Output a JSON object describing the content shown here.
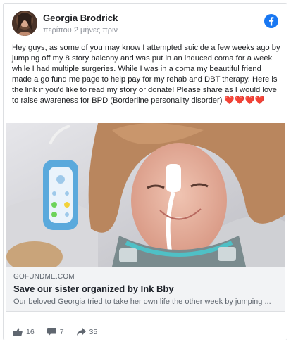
{
  "post": {
    "author": "Georgia Brodrick",
    "timestamp": "περίπου 2 μήνες πριν",
    "text": "Hey guys, as some of you may know I attempted suicide a few weeks ago by jumping off my 8 story balcony and was put in an induced coma for a week while I had multiple surgeries. While I was in a coma my beautiful friend made a go fund me page to help pay for my rehab and DBT therapy. Here is the link if you'd like to read my story or donate! Please share as I would love to raise awareness for BPD (Borderline personality disorder) ",
    "hearts": "❤️❤️❤️❤️"
  },
  "link": {
    "domain": "GOFUNDME.COM",
    "title": "Save our sister organized by Ink Bby",
    "description": "Our beloved Georgia tried to take her own life the other week by jumping ..."
  },
  "actions": {
    "likes": "16",
    "comments": "7",
    "shares": "35"
  },
  "colors": {
    "facebook_blue": "#1877f2",
    "heart_red": "#e0245e",
    "secondary_text": "#606770"
  },
  "icons": [
    "facebook-logo-icon",
    "like-icon",
    "comment-icon",
    "share-icon"
  ]
}
